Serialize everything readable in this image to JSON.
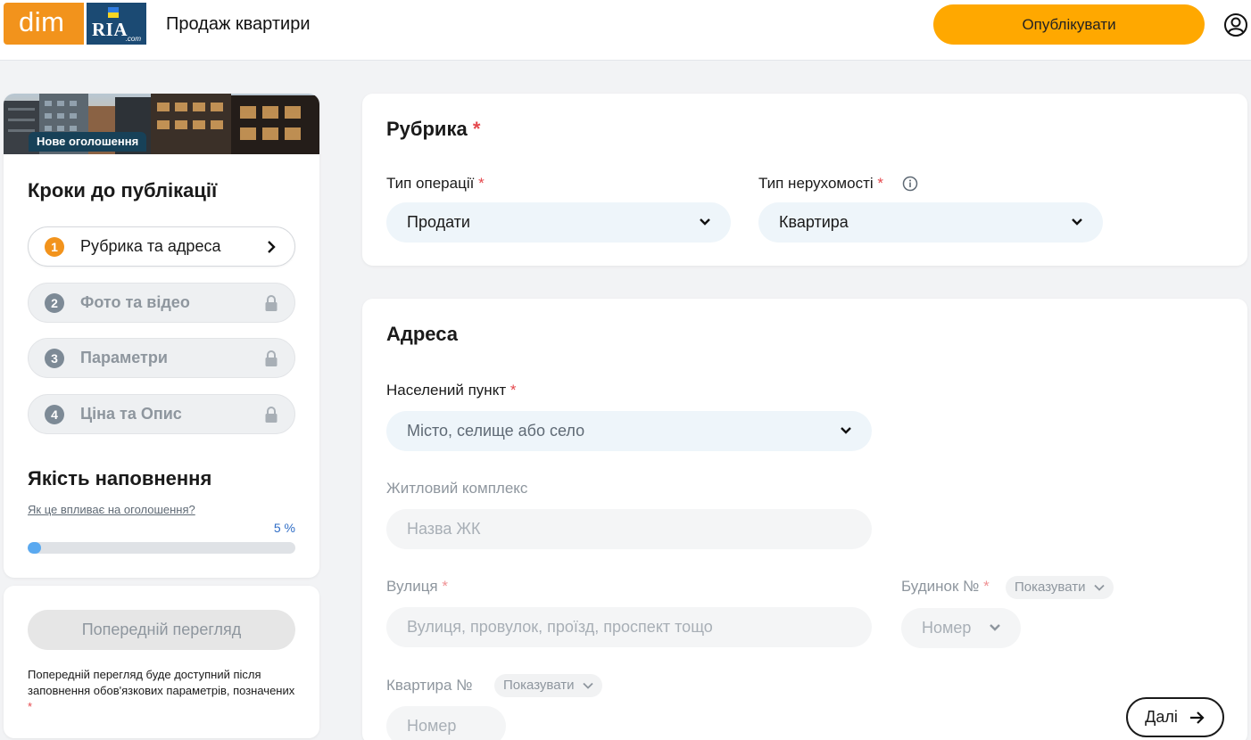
{
  "header": {
    "logo_dim": "dim",
    "logo_ria": "RIA",
    "logo_ria_com": ".com",
    "title": "Продаж квартири",
    "publish_label": "Опублікувати"
  },
  "sidebar": {
    "banner_badge": "Нове оголошення",
    "steps_title": "Кроки до публікації",
    "steps": [
      {
        "num": "1",
        "label": "Рубрика та адреса",
        "state": "active"
      },
      {
        "num": "2",
        "label": "Фото та відео",
        "state": "locked"
      },
      {
        "num": "3",
        "label": "Параметри",
        "state": "locked"
      },
      {
        "num": "4",
        "label": "Ціна та Опис",
        "state": "locked"
      }
    ],
    "quality_title": "Якість наповнення",
    "quality_link": "Як це впливає на оголошення?",
    "quality_percent_label": "5 %",
    "quality_fraction": 0.05
  },
  "preview": {
    "button_label": "Попередній перегляд",
    "note": "Попередній перегляд буде доступний після заповнення обов'язкових параметрів, позначених",
    "note_star": "*"
  },
  "rubrika": {
    "title": "Рубрика",
    "operation_label": "Тип операції",
    "operation_value": "Продати",
    "property_label": "Тип нерухомості",
    "property_value": "Квартира",
    "required_mark": "*"
  },
  "address": {
    "title": "Адреса",
    "locality_label": "Населений пункт",
    "locality_placeholder": "Місто, селище або село",
    "complex_label": "Житловий комплекс",
    "complex_placeholder": "Назва ЖК",
    "street_label": "Вулиця",
    "street_placeholder": "Вулиця, провулок, проїзд, проспект тощо",
    "house_label": "Будинок №",
    "house_placeholder": "Номер",
    "house_show": "Показувати",
    "apartment_label": "Квартира №",
    "apartment_placeholder": "Номер",
    "apartment_show": "Показувати",
    "required_mark": "*"
  },
  "next_label": "Далі",
  "colors": {
    "accent_orange": "#ffa800",
    "dim_orange": "#f2931c",
    "ria_blue": "#1b4a73",
    "progress_blue": "#5aa9f0",
    "required_red": "#e5484d"
  }
}
